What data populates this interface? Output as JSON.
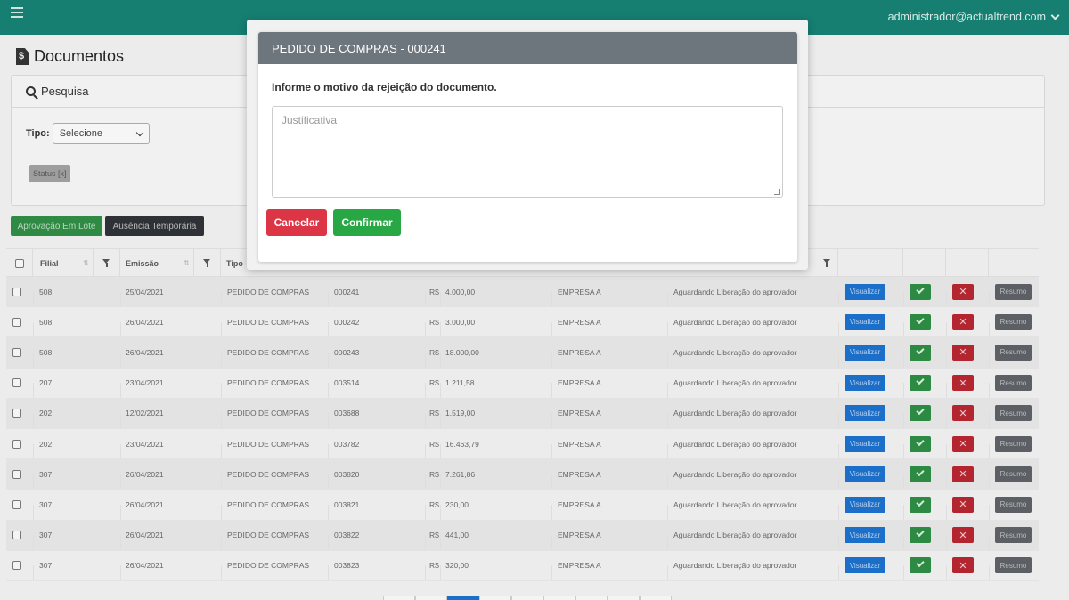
{
  "topbar": {
    "user": "administrador@actualtrend.com"
  },
  "page": {
    "title": "Documentos"
  },
  "search": {
    "title": "Pesquisa",
    "tipo_label": "Tipo:",
    "tipo_value": "Selecione",
    "status_chip": "Status [x]"
  },
  "actions": {
    "lote": "Aprovação Em Lote",
    "ausencia": "Ausência Temporária"
  },
  "table": {
    "headers": {
      "filial": "Filial",
      "emissao": "Emissão",
      "tipo": "Tipo"
    },
    "buttons": {
      "visualizar": "Visualizar",
      "resumo": "Resumo",
      "reject": "✕"
    },
    "rows": [
      {
        "filial": "508",
        "emissao": "25/04/2021",
        "tipo": "PEDIDO DE COMPRAS",
        "numero": "000241",
        "moeda": "R$",
        "valor": "4.000,00",
        "empresa": "EMPRESA A",
        "status": "Aguardando Liberação do aprovador"
      },
      {
        "filial": "508",
        "emissao": "26/04/2021",
        "tipo": "PEDIDO DE COMPRAS",
        "numero": "000242",
        "moeda": "R$",
        "valor": "3.000,00",
        "empresa": "EMPRESA A",
        "status": "Aguardando Liberação do aprovador"
      },
      {
        "filial": "508",
        "emissao": "26/04/2021",
        "tipo": "PEDIDO DE COMPRAS",
        "numero": "000243",
        "moeda": "R$",
        "valor": "18.000,00",
        "empresa": "EMPRESA A",
        "status": "Aguardando Liberação do aprovador"
      },
      {
        "filial": "207",
        "emissao": "23/04/2021",
        "tipo": "PEDIDO DE COMPRAS",
        "numero": "003514",
        "moeda": "R$",
        "valor": "1.211,58",
        "empresa": "EMPRESA A",
        "status": "Aguardando Liberação do aprovador"
      },
      {
        "filial": "202",
        "emissao": "12/02/2021",
        "tipo": "PEDIDO DE COMPRAS",
        "numero": "003688",
        "moeda": "R$",
        "valor": "1.519,00",
        "empresa": "EMPRESA A",
        "status": "Aguardando Liberação do aprovador"
      },
      {
        "filial": "202",
        "emissao": "23/04/2021",
        "tipo": "PEDIDO DE COMPRAS",
        "numero": "003782",
        "moeda": "R$",
        "valor": "16.463,79",
        "empresa": "EMPRESA A",
        "status": "Aguardando Liberação do aprovador"
      },
      {
        "filial": "307",
        "emissao": "26/04/2021",
        "tipo": "PEDIDO DE COMPRAS",
        "numero": "003820",
        "moeda": "R$",
        "valor": "7.261,86",
        "empresa": "EMPRESA A",
        "status": "Aguardando Liberação do aprovador"
      },
      {
        "filial": "307",
        "emissao": "26/04/2021",
        "tipo": "PEDIDO DE COMPRAS",
        "numero": "003821",
        "moeda": "R$",
        "valor": "230,00",
        "empresa": "EMPRESA A",
        "status": "Aguardando Liberação do aprovador"
      },
      {
        "filial": "307",
        "emissao": "26/04/2021",
        "tipo": "PEDIDO DE COMPRAS",
        "numero": "003822",
        "moeda": "R$",
        "valor": "441,00",
        "empresa": "EMPRESA A",
        "status": "Aguardando Liberação do aprovador"
      },
      {
        "filial": "307",
        "emissao": "26/04/2021",
        "tipo": "PEDIDO DE COMPRAS",
        "numero": "003823",
        "moeda": "R$",
        "valor": "320,00",
        "empresa": "EMPRESA A",
        "status": "Aguardando Liberação do aprovador"
      }
    ]
  },
  "modal": {
    "title": "PEDIDO DE COMPRAS - 000241",
    "label": "Informe o motivo da rejeição do documento.",
    "textarea_placeholder": "Justificativa",
    "textarea_value": "",
    "cancel": "Cancelar",
    "confirm": "Confirmar"
  },
  "colors": {
    "topbar": "#167f72",
    "primary": "#1b6fc9",
    "success": "#28a745",
    "danger": "#dc3545",
    "modal_header": "#6d757d"
  }
}
